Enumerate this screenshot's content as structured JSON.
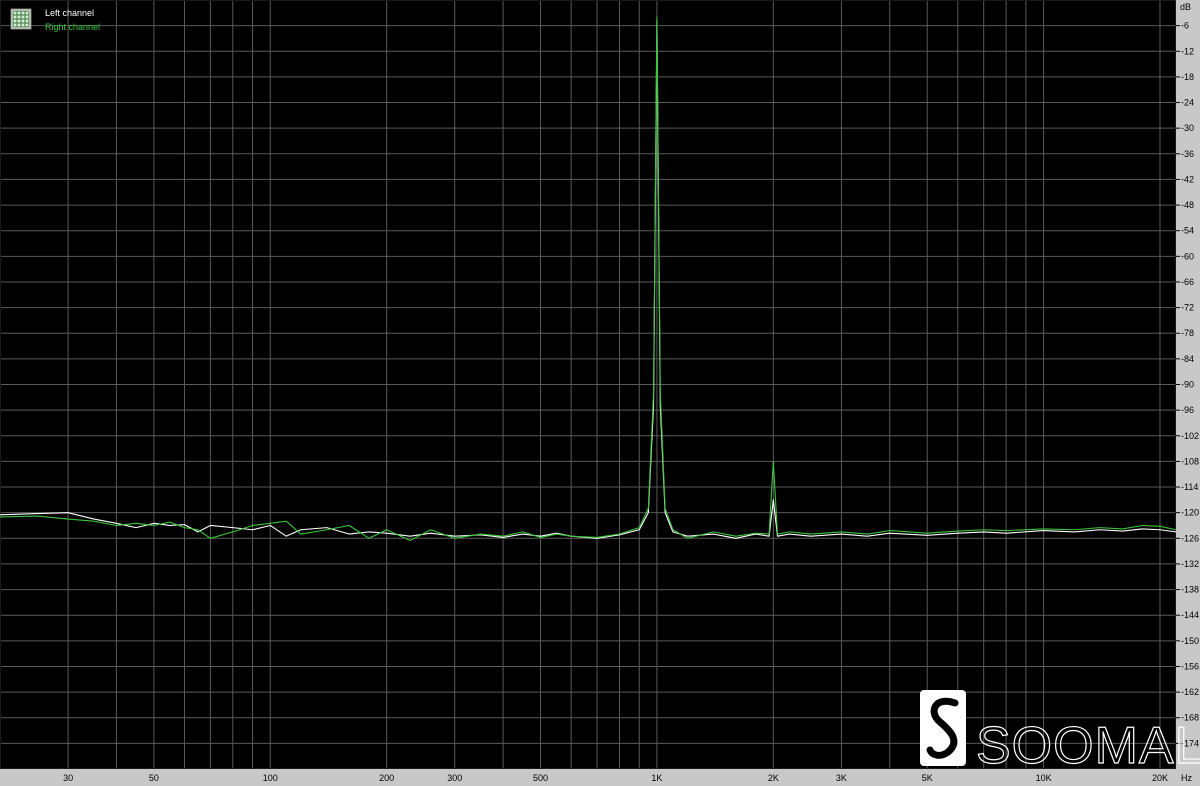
{
  "colors": {
    "plot_background": "#000000",
    "frame_background": "#c8c8c8",
    "grid": "#5a5a5a",
    "left_channel": "#ffffff",
    "right_channel": "#3cc43c",
    "axis_text": "#000000",
    "logo": "#ffffff"
  },
  "legend": {
    "icon": "grid-icon",
    "placement": "top-left",
    "items": [
      {
        "label": "Left channel",
        "color": "#ffffff"
      },
      {
        "label": "Right channel",
        "color": "#3cc43c"
      }
    ]
  },
  "watermark": {
    "text": "SOOMAL",
    "icon": "soomal-logo-icon"
  },
  "chart_data": {
    "type": "line",
    "title": "",
    "xlabel": "Hz",
    "ylabel": "dB",
    "xscale": "log",
    "xlim": [
      20,
      22000
    ],
    "ylim": [
      -180,
      0
    ],
    "grid": true,
    "legend_placement": "top-left",
    "x_ticks": [
      {
        "value": 30,
        "label": "30"
      },
      {
        "value": 50,
        "label": "50"
      },
      {
        "value": 100,
        "label": "100"
      },
      {
        "value": 200,
        "label": "200"
      },
      {
        "value": 300,
        "label": "300"
      },
      {
        "value": 500,
        "label": "500"
      },
      {
        "value": 1000,
        "label": "1K"
      },
      {
        "value": 2000,
        "label": "2K"
      },
      {
        "value": 3000,
        "label": "3K"
      },
      {
        "value": 5000,
        "label": "5K"
      },
      {
        "value": 10000,
        "label": "10K"
      },
      {
        "value": 20000,
        "label": "20K"
      }
    ],
    "x_minor_gridlines": [
      20,
      40,
      60,
      70,
      80,
      90,
      400,
      600,
      700,
      800,
      900,
      4000,
      6000,
      7000,
      8000,
      9000
    ],
    "y_ticks": [
      -6,
      -12,
      -18,
      -24,
      -30,
      -36,
      -42,
      -48,
      -54,
      -60,
      -66,
      -72,
      -78,
      -84,
      -90,
      -96,
      -102,
      -108,
      -114,
      -120,
      -126,
      -132,
      -138,
      -144,
      -150,
      -156,
      -162,
      -168,
      -174
    ],
    "series": [
      {
        "name": "Left channel",
        "color": "#ffffff",
        "points": [
          [
            20,
            -120.5
          ],
          [
            25,
            -120.2
          ],
          [
            30,
            -120.0
          ],
          [
            35,
            -121.5
          ],
          [
            40,
            -122.5
          ],
          [
            45,
            -123.5
          ],
          [
            50,
            -122.5
          ],
          [
            55,
            -123.0
          ],
          [
            60,
            -122.8
          ],
          [
            65,
            -124.5
          ],
          [
            70,
            -123.0
          ],
          [
            80,
            -123.5
          ],
          [
            90,
            -124.0
          ],
          [
            100,
            -123.0
          ],
          [
            110,
            -125.5
          ],
          [
            120,
            -124.0
          ],
          [
            140,
            -123.5
          ],
          [
            160,
            -125.0
          ],
          [
            180,
            -124.5
          ],
          [
            200,
            -124.8
          ],
          [
            230,
            -125.5
          ],
          [
            260,
            -124.8
          ],
          [
            300,
            -125.5
          ],
          [
            350,
            -125.2
          ],
          [
            400,
            -125.8
          ],
          [
            450,
            -125.0
          ],
          [
            500,
            -125.5
          ],
          [
            550,
            -124.8
          ],
          [
            600,
            -125.5
          ],
          [
            700,
            -126.0
          ],
          [
            800,
            -125.2
          ],
          [
            900,
            -124.0
          ],
          [
            950,
            -120.0
          ],
          [
            980,
            -95.0
          ],
          [
            1000,
            -5.0
          ],
          [
            1020,
            -95.0
          ],
          [
            1050,
            -120.0
          ],
          [
            1100,
            -124.5
          ],
          [
            1200,
            -125.5
          ],
          [
            1400,
            -125.0
          ],
          [
            1600,
            -126.0
          ],
          [
            1800,
            -125.0
          ],
          [
            1950,
            -125.5
          ],
          [
            2000,
            -117.0
          ],
          [
            2050,
            -125.5
          ],
          [
            2200,
            -125.0
          ],
          [
            2500,
            -125.5
          ],
          [
            3000,
            -125.0
          ],
          [
            3500,
            -125.5
          ],
          [
            4000,
            -124.8
          ],
          [
            5000,
            -125.3
          ],
          [
            6000,
            -124.8
          ],
          [
            7000,
            -124.5
          ],
          [
            8000,
            -124.8
          ],
          [
            10000,
            -124.2
          ],
          [
            12000,
            -124.5
          ],
          [
            14000,
            -124.0
          ],
          [
            16000,
            -124.3
          ],
          [
            18000,
            -123.8
          ],
          [
            20000,
            -124.0
          ],
          [
            22000,
            -124.5
          ]
        ]
      },
      {
        "name": "Right channel",
        "color": "#3cc43c",
        "points": [
          [
            20,
            -121.0
          ],
          [
            25,
            -120.8
          ],
          [
            30,
            -121.5
          ],
          [
            35,
            -122.0
          ],
          [
            40,
            -123.0
          ],
          [
            45,
            -122.5
          ],
          [
            50,
            -123.0
          ],
          [
            55,
            -122.2
          ],
          [
            60,
            -123.5
          ],
          [
            65,
            -124.0
          ],
          [
            70,
            -126.0
          ],
          [
            80,
            -124.5
          ],
          [
            90,
            -123.0
          ],
          [
            100,
            -122.5
          ],
          [
            110,
            -122.0
          ],
          [
            120,
            -125.0
          ],
          [
            140,
            -124.0
          ],
          [
            160,
            -123.0
          ],
          [
            180,
            -126.0
          ],
          [
            200,
            -124.0
          ],
          [
            230,
            -126.5
          ],
          [
            260,
            -124.0
          ],
          [
            300,
            -126.0
          ],
          [
            350,
            -125.0
          ],
          [
            400,
            -125.5
          ],
          [
            450,
            -124.5
          ],
          [
            500,
            -125.8
          ],
          [
            550,
            -125.0
          ],
          [
            600,
            -125.5
          ],
          [
            700,
            -125.8
          ],
          [
            800,
            -125.0
          ],
          [
            900,
            -123.5
          ],
          [
            950,
            -119.0
          ],
          [
            980,
            -92.0
          ],
          [
            1000,
            -4.0
          ],
          [
            1020,
            -92.0
          ],
          [
            1050,
            -119.0
          ],
          [
            1100,
            -124.0
          ],
          [
            1200,
            -126.0
          ],
          [
            1400,
            -124.5
          ],
          [
            1600,
            -125.5
          ],
          [
            1800,
            -124.8
          ],
          [
            1950,
            -125.0
          ],
          [
            2000,
            -108.0
          ],
          [
            2050,
            -125.0
          ],
          [
            2200,
            -124.5
          ],
          [
            2500,
            -125.0
          ],
          [
            3000,
            -124.5
          ],
          [
            3500,
            -125.0
          ],
          [
            4000,
            -124.2
          ],
          [
            5000,
            -124.8
          ],
          [
            6000,
            -124.3
          ],
          [
            7000,
            -124.0
          ],
          [
            8000,
            -124.2
          ],
          [
            10000,
            -123.8
          ],
          [
            12000,
            -124.0
          ],
          [
            14000,
            -123.5
          ],
          [
            16000,
            -123.8
          ],
          [
            18000,
            -123.0
          ],
          [
            20000,
            -123.2
          ],
          [
            22000,
            -124.0
          ]
        ]
      }
    ],
    "x_unit_label": "Hz",
    "y_unit_label": "dB"
  }
}
